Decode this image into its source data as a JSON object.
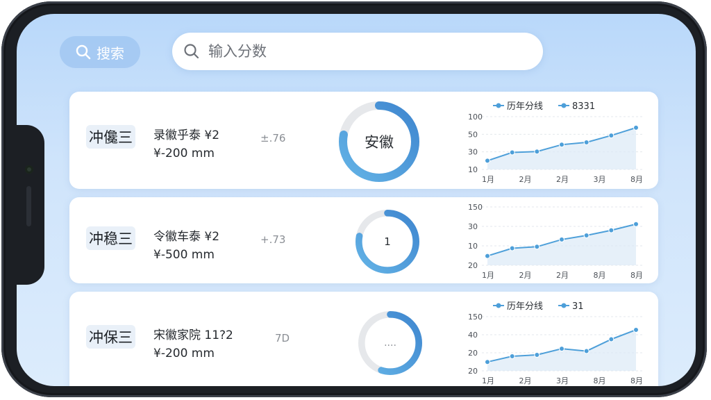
{
  "search": {
    "button_label": "搜索",
    "input_value": "输入分数",
    "placeholder": "输入分数"
  },
  "colors": {
    "accent": "#4d9fd9",
    "donut_track": "#e6e8eb",
    "screen_bg": "#c8e0fa"
  },
  "cards": [
    {
      "name": "冲儳三",
      "line1": "录徽乎泰 ¥2",
      "line2": "¥-200 mm",
      "score": "±.76",
      "donut_label": "安徽",
      "donut_progress": 0.78,
      "chart": {
        "legend": [
          "历年分线",
          "8331"
        ],
        "y_ticks": [
          "100",
          "50",
          "30",
          "10"
        ],
        "x_ticks": [
          "1月",
          "2月",
          "2月",
          "3月",
          "8月"
        ],
        "values": [
          10,
          28,
          30,
          45,
          50,
          65,
          82
        ]
      }
    },
    {
      "name": "冲稳三",
      "line1": "令徽车泰 ¥2",
      "line2": "¥-500 mm",
      "score": "+.73",
      "donut_label": "1",
      "donut_progress": 0.78,
      "chart": {
        "legend": [],
        "y_ticks": [
          "150",
          "30",
          "10",
          "20"
        ],
        "x_ticks": [
          "1月",
          "2月",
          "2月",
          "8月",
          "8月"
        ],
        "values": [
          10,
          25,
          28,
          42,
          50,
          60,
          72
        ]
      }
    },
    {
      "name": "冲保三",
      "line1": "宋徽家院 11?2",
      "line2": "¥-200 mm",
      "score": "7D",
      "donut_label": "....",
      "donut_progress": 0.55,
      "chart": {
        "legend": [
          "历年分线",
          "31"
        ],
        "y_ticks": [
          "150",
          "40",
          "20",
          "20"
        ],
        "x_ticks": [
          "1月",
          "2月",
          "3月",
          "8月",
          "8月"
        ],
        "values": [
          10,
          22,
          25,
          38,
          33,
          58,
          78
        ]
      }
    }
  ]
}
